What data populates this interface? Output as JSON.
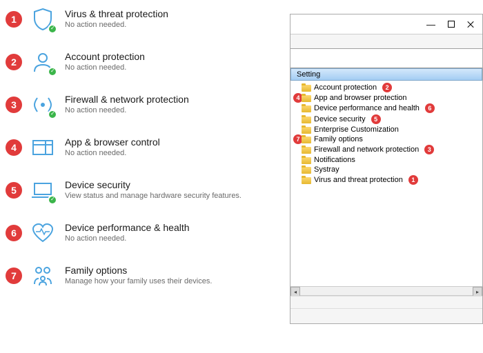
{
  "security_items": [
    {
      "num": "1",
      "title": "Virus & threat protection",
      "sub": "No action needed.",
      "icon": "shield",
      "check": true
    },
    {
      "num": "2",
      "title": "Account protection",
      "sub": "No action needed.",
      "icon": "account",
      "check": true
    },
    {
      "num": "3",
      "title": "Firewall & network protection",
      "sub": "No action needed.",
      "icon": "firewall",
      "check": true
    },
    {
      "num": "4",
      "title": "App & browser control",
      "sub": "No action needed.",
      "icon": "app",
      "check": false
    },
    {
      "num": "5",
      "title": "Device security",
      "sub": "View status and manage hardware security features.",
      "icon": "device",
      "check": true
    },
    {
      "num": "6",
      "title": "Device performance & health",
      "sub": "No action needed.",
      "icon": "health",
      "check": false
    },
    {
      "num": "7",
      "title": "Family options",
      "sub": "Manage how your family uses their devices.",
      "icon": "family",
      "check": false
    }
  ],
  "tree": {
    "header": "Setting",
    "items": [
      {
        "label": "Account protection",
        "ref": "2"
      },
      {
        "label": "App and browser protection",
        "ref": "4",
        "ref_before": true
      },
      {
        "label": "Device performance and health",
        "ref": "6"
      },
      {
        "label": "Device security",
        "ref": "5"
      },
      {
        "label": "Enterprise Customization",
        "ref": null
      },
      {
        "label": "Family options",
        "ref": "7",
        "ref_before": true
      },
      {
        "label": "Firewall and network protection",
        "ref": "3"
      },
      {
        "label": "Notifications",
        "ref": null
      },
      {
        "label": "Systray",
        "ref": null
      },
      {
        "label": "Virus and threat protection",
        "ref": "1"
      }
    ]
  }
}
